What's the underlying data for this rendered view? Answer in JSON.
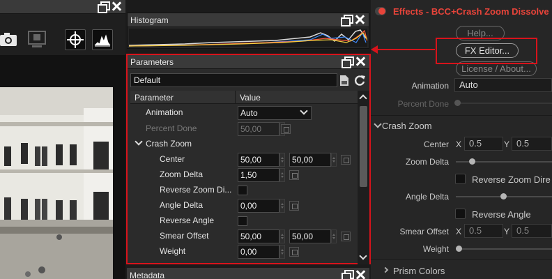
{
  "histogram": {
    "title": "Histogram"
  },
  "parameters": {
    "title": "Parameters",
    "preset": "Default",
    "columns": {
      "parameter": "Parameter",
      "value": "Value"
    },
    "animation": {
      "label": "Animation",
      "value": "Auto"
    },
    "percent_done": {
      "label": "Percent Done",
      "value": "50,00"
    },
    "crash_zoom": {
      "label": "Crash Zoom"
    },
    "center": {
      "label": "Center",
      "x": "50,00",
      "y": "50,00"
    },
    "zoom_delta": {
      "label": "Zoom Delta",
      "value": "1,50"
    },
    "reverse_zoom": {
      "label": "Reverse Zoom Di..."
    },
    "angle_delta": {
      "label": "Angle Delta",
      "value": "0,00"
    },
    "reverse_angle": {
      "label": "Reverse Angle"
    },
    "smear_offset": {
      "label": "Smear Offset",
      "x": "50,00",
      "y": "50,00"
    },
    "weight": {
      "label": "Weight",
      "value": "0,00"
    }
  },
  "metadata": {
    "title": "Metadata"
  },
  "inspector": {
    "title": "Effects - BCC+Crash Zoom Dissolve",
    "help": "Help...",
    "fx_editor": "FX Editor...",
    "license": "License / About...",
    "animation": {
      "label": "Animation",
      "value": "Auto"
    },
    "percent_done": {
      "label": "Percent Done"
    },
    "crash_zoom": "Crash Zoom",
    "center": {
      "label": "Center",
      "x_axis": "X",
      "x": "0.5",
      "y_axis": "Y",
      "y": "0.5"
    },
    "zoom_delta": {
      "label": "Zoom Delta"
    },
    "reverse_zoom": "Reverse Zoom Dire",
    "angle_delta": {
      "label": "Angle Delta"
    },
    "reverse_angle": "Reverse Angle",
    "smear_offset": {
      "label": "Smear Offset",
      "x_axis": "X",
      "x": "0.5",
      "y_axis": "Y",
      "y": "0.5"
    },
    "weight": {
      "label": "Weight"
    },
    "prism_colors": "Prism Colors"
  },
  "colors": {
    "accent_red": "#d8131b",
    "title_red": "#e8443a"
  },
  "icons": [
    "restore-icon",
    "close-icon",
    "camera-icon",
    "snapshot-icon",
    "crosshair-icon",
    "scope-icon",
    "save-preset-icon",
    "refresh-icon",
    "chevron-down-icon",
    "chevron-right-icon"
  ]
}
